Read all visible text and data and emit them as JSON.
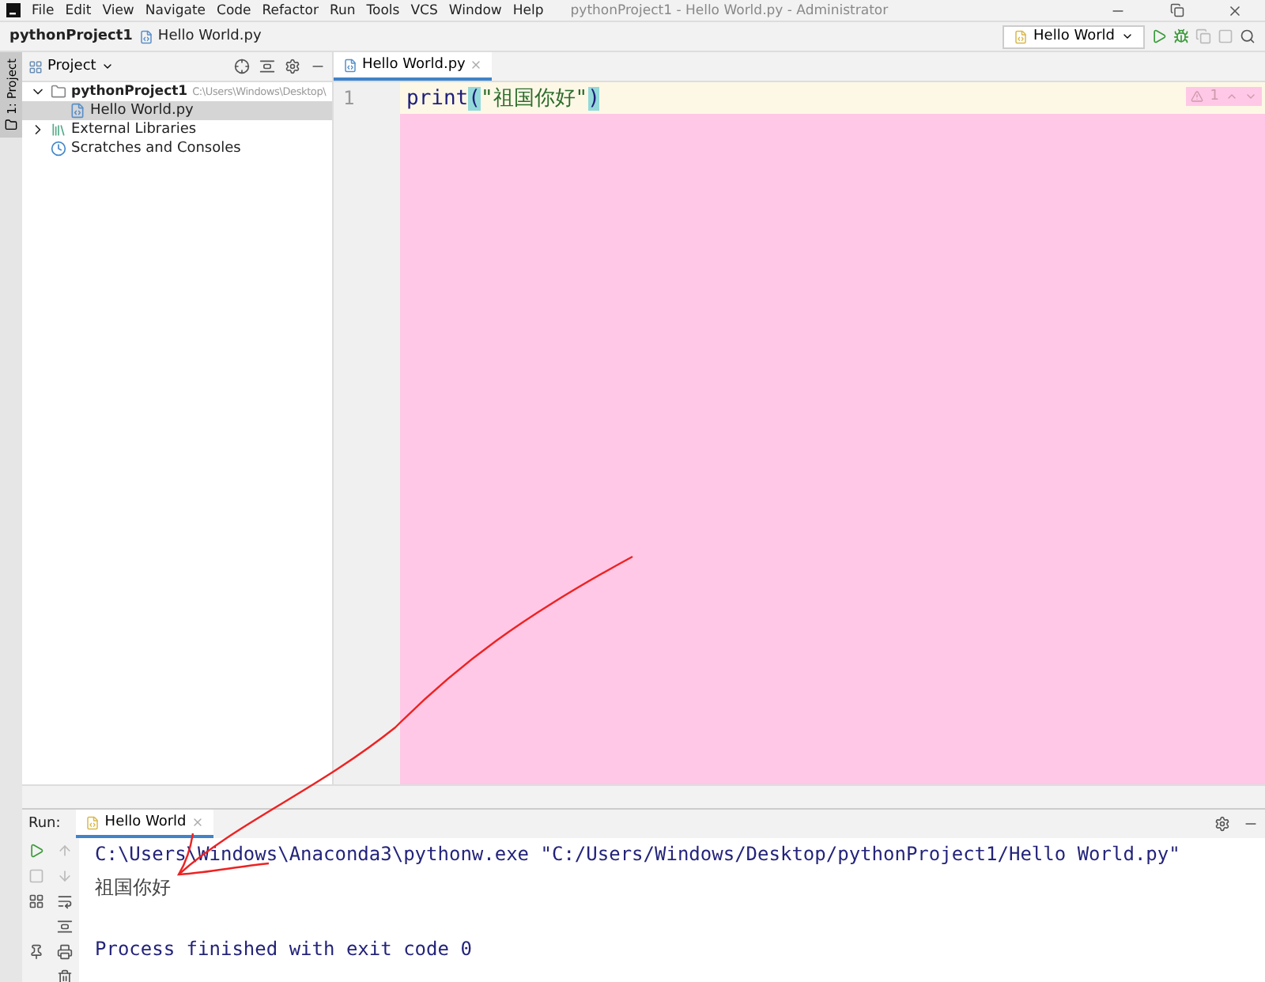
{
  "menu": [
    "File",
    "Edit",
    "View",
    "Navigate",
    "Code",
    "Refactor",
    "Run",
    "Tools",
    "VCS",
    "Window",
    "Help"
  ],
  "window_title": "pythonProject1 - Hello World.py - Administrator",
  "breadcrumb": [
    "pythonProject1",
    "Hello World.py"
  ],
  "run_config": "Hello World",
  "side_stripe": "1: Project",
  "project_panel": {
    "title": "Project",
    "tree": [
      {
        "label": "pythonProject1",
        "kind": "folder",
        "path": "C:\\Users\\Windows\\Desktop\\",
        "expanded": true,
        "selected": false,
        "children": [
          {
            "label": "Hello World.py",
            "kind": "python",
            "selected": true
          }
        ]
      },
      {
        "label": "External Libraries",
        "kind": "libraries",
        "expanded": false,
        "selected": false
      },
      {
        "label": "Scratches and Consoles",
        "kind": "scratches",
        "selected": false
      }
    ]
  },
  "editor": {
    "tabs": [
      {
        "label": "Hello World.py",
        "selected": true
      }
    ],
    "warnings": "1",
    "lines": [
      {
        "number": "1",
        "tokens": [
          {
            "text": "print",
            "kind": "plain"
          },
          {
            "text": "(",
            "kind": "matched"
          },
          {
            "text": "\"祖国你好\"",
            "kind": "string"
          },
          {
            "text": ")",
            "kind": "matched"
          }
        ]
      }
    ]
  },
  "run_panel": {
    "label": "Run:",
    "tabs": [
      {
        "label": "Hello World",
        "selected": true
      }
    ],
    "console": [
      {
        "kind": "command",
        "text": "C:\\Users\\Windows\\Anaconda3\\pythonw.exe \"C:/Users/Windows/Desktop/pythonProject1/Hello World.py\""
      },
      {
        "kind": "output",
        "text": "祖国你好"
      },
      {
        "kind": "blank"
      },
      {
        "kind": "status",
        "text": "Process finished with exit code 0"
      }
    ]
  }
}
